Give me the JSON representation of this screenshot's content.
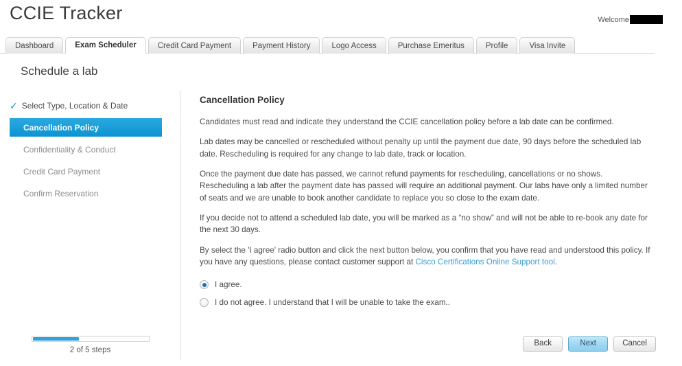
{
  "header": {
    "brand_title": "CCIE Tracker",
    "welcome_label": "Welcome",
    "redacted_name": ""
  },
  "tabs": [
    {
      "label": "Dashboard",
      "active": false
    },
    {
      "label": "Exam Scheduler",
      "active": true
    },
    {
      "label": "Credit Card Payment",
      "active": false
    },
    {
      "label": "Payment History",
      "active": false
    },
    {
      "label": "Logo Access",
      "active": false
    },
    {
      "label": "Purchase Emeritus",
      "active": false
    },
    {
      "label": "Profile",
      "active": false
    },
    {
      "label": "Visa Invite",
      "active": false
    }
  ],
  "page": {
    "title": "Schedule a lab"
  },
  "sidebar": {
    "steps": [
      {
        "label": "Select Type, Location & Date",
        "state": "done",
        "check_glyph": "✓"
      },
      {
        "label": "Cancellation Policy",
        "state": "current"
      },
      {
        "label": "Confidentiality & Conduct",
        "state": "pending"
      },
      {
        "label": "Credit Card Payment",
        "state": "pending"
      },
      {
        "label": "Confirm Reservation",
        "state": "pending"
      }
    ],
    "progress": {
      "label": "2 of 5 steps",
      "current": 2,
      "total": 5,
      "percent": 40,
      "fill_color": "#31a3db"
    }
  },
  "content": {
    "heading": "Cancellation Policy",
    "paragraphs": [
      "Candidates must read and indicate they understand the CCIE cancellation policy before a lab date can be confirmed.",
      "Lab dates may be cancelled or rescheduled without penalty up until the payment due date, 90 days before the scheduled lab date. Rescheduling is required for any change to lab date, track or location.",
      "Once the payment due date has passed, we cannot refund payments for rescheduling, cancellations or no shows. Rescheduling a lab after the payment date has passed will require an additional payment. Our labs have only a limited number of seats and we are unable to book another candidate to replace you so close to the exam date.",
      "If you decide not to attend a scheduled lab date, you will be marked as a “no show” and will not be able to re-book any date for the next 30 days."
    ],
    "final_paragraph": {
      "text_before": "By select the 'I agree' radio button and click the next button below, you confirm that you have read and understood this policy. If you have any questions, please contact customer support at ",
      "link_text": "Cisco Certifications Online Support tool",
      "text_after": "."
    },
    "radios": [
      {
        "label": "I agree.",
        "checked": true
      },
      {
        "label": "I do not agree. I understand that I will be unable to take the exam..",
        "checked": false
      }
    ]
  },
  "buttons": {
    "back": "Back",
    "next": "Next",
    "cancel": "Cancel"
  },
  "colors": {
    "accent_blue": "#0d93d2",
    "link_blue": "#3a9cd4",
    "primary_button": "#9fd9f2"
  }
}
